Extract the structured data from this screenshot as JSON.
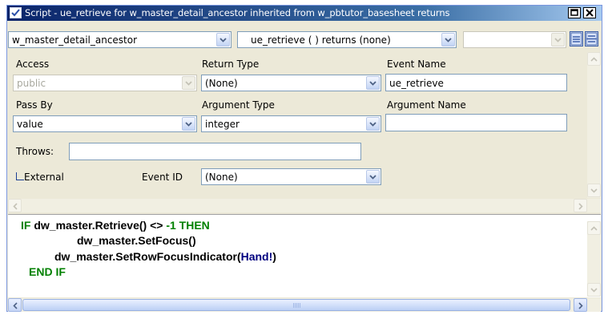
{
  "window": {
    "title": "Script - ue_retrieve for w_master_detail_ancestor inherited from w_pbtutor_basesheet returns",
    "icon": "script-icon",
    "controls": [
      "restore-icon",
      "close-icon"
    ]
  },
  "toolbar": {
    "object_combo": "w_master_detail_ancestor",
    "event_combo": "ue_retrieve ( ) returns (none)",
    "ancestor_combo": ""
  },
  "prototype": {
    "access_label": "Access",
    "access_value": "public",
    "return_type_label": "Return Type",
    "return_type_value": "(None)",
    "event_name_label": "Event Name",
    "event_name_value": "ue_retrieve",
    "pass_by_label": "Pass By",
    "pass_by_value": "value",
    "argument_type_label": "Argument Type",
    "argument_type_value": "integer",
    "argument_name_label": "Argument Name",
    "argument_name_value": "",
    "throws_label": "Throws:",
    "throws_value": "",
    "external_label": "External",
    "external_checked": false,
    "event_id_label": "Event ID",
    "event_id_value": "(None)"
  },
  "code": {
    "line1_if": "IF ",
    "line1_expr": "dw_master.Retrieve() <> ",
    "line1_num": "-1",
    "line1_then": " THEN",
    "line2": "dw_master.SetFocus()",
    "line3_prefix": "dw_master.SetRowFocusIndicator(",
    "line3_const": "Hand!",
    "line3_suffix": ")",
    "line4": "END IF"
  },
  "colors": {
    "keyword": "#008000",
    "constant": "#00007f",
    "titlebar": "#0a246a",
    "window_bg": "#ece9d8"
  }
}
